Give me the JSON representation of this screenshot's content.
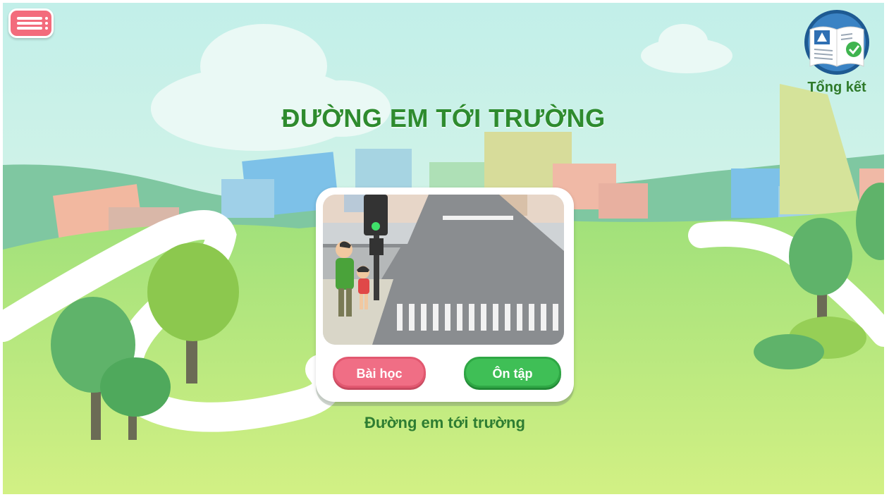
{
  "header": {
    "menu_icon": "hamburger-menu-icon",
    "summary_icon": "open-book-icon",
    "summary_label": "Tổng kết"
  },
  "main": {
    "title": "ĐƯỜNG EM TỚI TRƯỜNG",
    "card": {
      "lesson_button": "Bài học",
      "review_button": "Ôn tập",
      "caption": "Đường em tới trường"
    }
  },
  "colors": {
    "sky_top": "#bdeee9",
    "grass": "#c8ec80",
    "title_green": "#2e8b2e",
    "lesson_pink": "#f06e85",
    "review_green": "#3fbf56",
    "menu_pink": "#f36b7c"
  }
}
